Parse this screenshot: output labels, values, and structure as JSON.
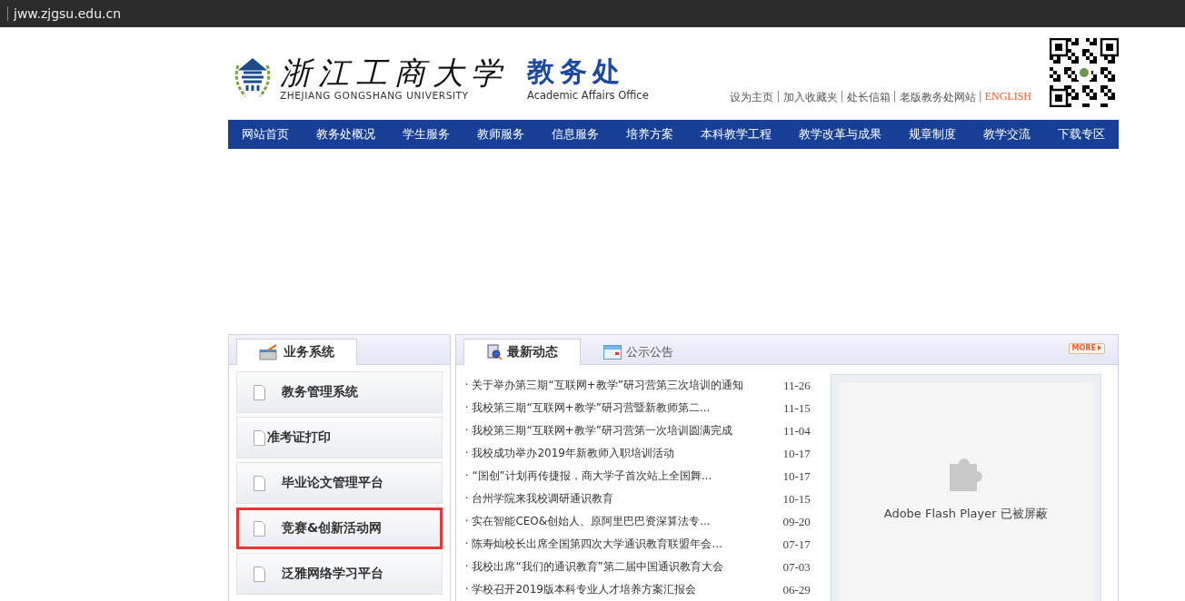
{
  "browser": {
    "url": "jww.zjgsu.edu.cn"
  },
  "header": {
    "school_name": "浙江工商大学",
    "school_name_en": "ZHEJIANG GONGSHANG UNIVERSITY",
    "office_name": "教务处",
    "office_name_en": "Academic Affairs Office",
    "top_links": [
      {
        "label": "设为主页",
        "kind": "normal"
      },
      {
        "label": "加入收藏夹",
        "kind": "normal"
      },
      {
        "label": "处长信箱",
        "kind": "normal"
      },
      {
        "label": "老版教务处网站",
        "kind": "normal"
      },
      {
        "label": "ENGLISH",
        "kind": "accent"
      }
    ],
    "separator": "|"
  },
  "nav": [
    "网站首页",
    "教务处概况",
    "学生服务",
    "教师服务",
    "信息服务",
    "培养方案",
    "本科教学工程",
    "教学改革与成果",
    "规章制度",
    "教学交流",
    "下载专区"
  ],
  "systems": {
    "tab": "业务系统",
    "items": [
      {
        "label": "教务管理系统",
        "highlighted": false,
        "kind": "indented"
      },
      {
        "label": "准考证打印",
        "highlighted": false,
        "kind": "tight"
      },
      {
        "label": "毕业论文管理平台",
        "highlighted": false,
        "kind": "indented"
      },
      {
        "label": "竞赛&创新活动网",
        "highlighted": true,
        "kind": "indented"
      },
      {
        "label": "泛雅网络学习平台",
        "highlighted": false,
        "kind": "indented"
      }
    ]
  },
  "news": {
    "tabs": [
      {
        "label": "最新动态",
        "selected": true
      },
      {
        "label": "公示公告",
        "selected": false
      }
    ],
    "more": "MORE",
    "items": [
      {
        "title": "· 关于举办第三期“互联网+教学”研习营第三次培训的通知",
        "date": "11-26"
      },
      {
        "title": "· 我校第三期“互联网+教学”研习营暨新教师第二...",
        "date": "11-15"
      },
      {
        "title": "· 我校第三期“互联网+教学”研习营第一次培训圆满完成",
        "date": "11-04"
      },
      {
        "title": "· 我校成功举办2019年新教师入职培训活动",
        "date": "10-17"
      },
      {
        "title": "· “国创”计划再传捷报，商大学子首次站上全国舞...",
        "date": "10-17"
      },
      {
        "title": "· 台州学院来我校调研通识教育",
        "date": "10-15"
      },
      {
        "title": "· 实在智能CEO&创始人、原阿里巴巴资深算法专...",
        "date": "09-20"
      },
      {
        "title": "· 陈寿灿校长出席全国第四次大学通识教育联盟年会...",
        "date": "07-17"
      },
      {
        "title": "· 我校出席“我们的通识教育”第二届中国通识教育大会",
        "date": "07-03"
      },
      {
        "title": "· 学校召开2019版本科专业人才培养方案汇报会",
        "date": "06-29"
      }
    ],
    "plugin_message": "Adobe Flash Player 已被屏蔽"
  }
}
